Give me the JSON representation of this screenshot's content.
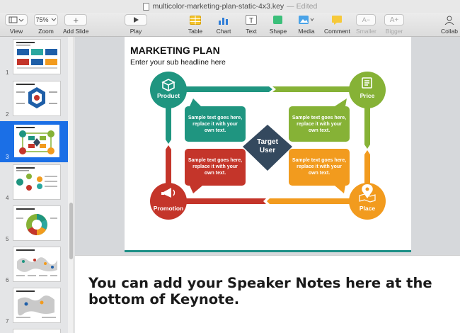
{
  "window": {
    "title": "multicolor-marketing-plan-static-4x3.key",
    "status": "— Edited"
  },
  "toolbar": {
    "view_label": "View",
    "zoom_label": "Zoom",
    "zoom_value": "75%",
    "add_slide_label": "Add Slide",
    "play_label": "Play",
    "table_label": "Table",
    "chart_label": "Chart",
    "text_label": "Text",
    "shape_label": "Shape",
    "media_label": "Media",
    "comment_label": "Comment",
    "smaller_label": "Smaller",
    "bigger_label": "Bigger",
    "collab_label": "Collab"
  },
  "sidebar": {
    "slides": [
      {
        "number": "1"
      },
      {
        "number": "2"
      },
      {
        "number": "3",
        "selected": true
      },
      {
        "number": "4"
      },
      {
        "number": "5"
      },
      {
        "number": "6"
      },
      {
        "number": "7"
      }
    ]
  },
  "slide": {
    "title": "MARKETING PLAN",
    "subtitle": "Enter your sub headline here",
    "center_label_line1": "Target",
    "center_label_line2": "User",
    "nodes": {
      "product": "Product",
      "price": "Price",
      "promotion": "Promotion",
      "place": "Place"
    },
    "boxes": [
      {
        "line1": "Sample text goes here,",
        "line2": "replace it with your",
        "line3": "own text."
      },
      {
        "line1": "Sample text goes here,",
        "line2": "replace it with your",
        "line3": "own text."
      },
      {
        "line1": "Sample text goes here,",
        "line2": "replace it with your",
        "line3": "own text."
      },
      {
        "line1": "Sample text goes here,",
        "line2": "replace it with your",
        "line3": "own text."
      }
    ],
    "colors": {
      "teal": "#1f9580",
      "green": "#86b236",
      "red": "#c4352a",
      "orange": "#f29b1e",
      "navy": "#34495e",
      "accent_line": "#1d8f86"
    }
  },
  "notes": {
    "text": "You can add your Speaker Notes here at the bottom of Keynote."
  }
}
